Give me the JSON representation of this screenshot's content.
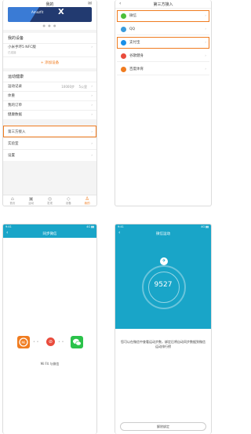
{
  "colors": {
    "accent": "#f07c20",
    "header": "#19a5c8"
  },
  "p1": {
    "title": "我的",
    "banner_text": "Amazfit",
    "banner_x": "X",
    "dots": "● ● ●",
    "sec1_title": "我的设备",
    "device_name": "小米手环5 NFC版",
    "device_sub": "已连接",
    "add_device": "+ 添加设备",
    "sec2_title": "运动健康",
    "rows": [
      {
        "label": "运动记录",
        "val": "10000步",
        "val2": "5公里",
        "hl": false
      },
      {
        "label": "体重",
        "val": "",
        "val2": "",
        "hl": false
      },
      {
        "label": "我的订单",
        "val": "",
        "val2": "",
        "hl": false
      },
      {
        "label": "健康数据",
        "val": "",
        "val2": "",
        "hl": false
      }
    ],
    "sec3_rows": [
      {
        "label": "第三方接入",
        "hl": true
      },
      {
        "label": "实验室",
        "hl": false
      },
      {
        "label": "设置",
        "hl": false
      }
    ],
    "tabs": [
      {
        "icon": "⌂",
        "label": "首页"
      },
      {
        "icon": "▣",
        "label": "运动"
      },
      {
        "icon": "◎",
        "label": "发现"
      },
      {
        "icon": "◇",
        "label": "设备"
      },
      {
        "icon": "♙",
        "label": "我的"
      }
    ]
  },
  "p2": {
    "title": "第三方接入",
    "apps": [
      {
        "label": "微信",
        "color": "#4cbf3a",
        "hl": true
      },
      {
        "label": "QQ",
        "color": "#3a9bdc",
        "hl": false
      },
      {
        "label": "支付宝",
        "color": "#1a8fe8",
        "hl": true
      },
      {
        "label": "谷歌健身",
        "color": "#e94b3c",
        "hl": false
      },
      {
        "label": "百度体育",
        "color": "#f07c20",
        "hl": false
      }
    ]
  },
  "p3": {
    "status_l": "9:41",
    "status_r": "4G ▮▮",
    "title": "同步微信",
    "label": "Mi Fit 与微信"
  },
  "p4": {
    "status_l": "9:41",
    "status_r": "4G ▮▮",
    "title": "微信运动",
    "count": "9527",
    "msg": "您可以在微信中查看运动步数，绑定后将自动同步数据到微信运动排行榜",
    "btn": "解除绑定"
  }
}
